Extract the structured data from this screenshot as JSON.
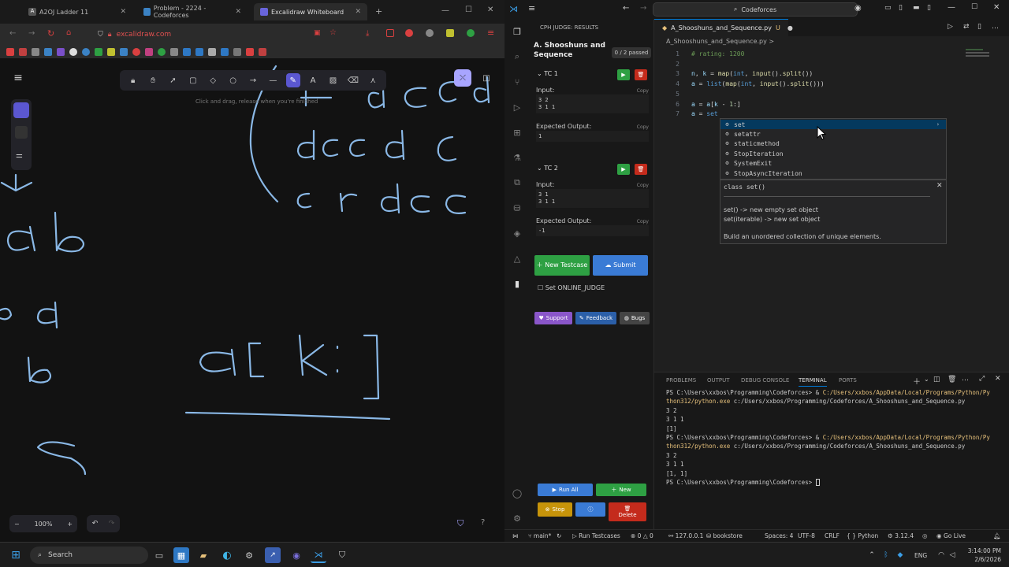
{
  "browser": {
    "tabs": [
      {
        "title": "A2OJ Ladder 11"
      },
      {
        "title": "Problem - 2224 - Codeforces"
      },
      {
        "title": "Excalidraw Whiteboard"
      }
    ],
    "url": "excalidraw.com"
  },
  "excalidraw": {
    "hint": "Click and drag, release when you're finished",
    "zoom": "100%"
  },
  "vscode": {
    "search": "Codeforces",
    "cph": {
      "header": "CPH JUDGE: RESULTS",
      "problem": "A. Shooshuns and Sequence",
      "passed": "0 / 2 passed",
      "testcases": [
        {
          "title": "TC 1",
          "input_label": "Input:",
          "input": "3 2\n3 1 1",
          "expected_label": "Expected Output:",
          "expected": "1",
          "copy": "Copy"
        },
        {
          "title": "TC 2",
          "input_label": "Input:",
          "input": "3 1\n3 1 1",
          "expected_label": "Expected Output:",
          "expected": "-1",
          "copy": "Copy"
        }
      ],
      "new_testcase": "New Testcase",
      "submit": "Submit",
      "online_judge": "Set ONLINE_JUDGE",
      "support": "Support",
      "feedback": "Feedback",
      "bugs": "Bugs",
      "run_all": "Run All",
      "new": "New",
      "stop": "Stop",
      "delete": "Delete"
    },
    "editor": {
      "tab": "A_Shooshuns_and_Sequence.py",
      "tab_status": "U",
      "breadcrumb": "A_Shooshuns_and_Sequence.py >",
      "suggestions": [
        "set",
        "setattr",
        "staticmethod",
        "StopIteration",
        "SystemExit",
        "StopAsyncIteration"
      ],
      "doc": {
        "signature": "class set()",
        "line1": "set() -> new empty set object",
        "line2": "set(iterable) -> new set object",
        "line3": "Build an unordered collection of unique elements."
      }
    },
    "panel": {
      "tabs": [
        "PROBLEMS",
        "OUTPUT",
        "DEBUG CONSOLE",
        "TERMINAL",
        "PORTS"
      ],
      "terminal": [
        {
          "prompt": "PS C:\\Users\\xxbos\\Programming\\Codeforces> & ",
          "path": "C:/Users/xxbos/AppData/Local/Programs/Python/Py"
        },
        {
          "prompt": "",
          "path": "thon312/python.exe",
          "rest": " c:/Users/xxbos/Programming/Codeforces/A_Shooshuns_and_Sequence.py"
        },
        {
          "prompt": "3 2"
        },
        {
          "prompt": "3 1 1"
        },
        {
          "prompt": "[1]"
        },
        {
          "prompt": "PS C:\\Users\\xxbos\\Programming\\Codeforces> & ",
          "path": "C:/Users/xxbos/AppData/Local/Programs/Python/Py"
        },
        {
          "prompt": "",
          "path": "thon312/python.exe",
          "rest": " c:/Users/xxbos/Programming/Codeforces/A_Shooshuns_and_Sequence.py"
        },
        {
          "prompt": "3 2"
        },
        {
          "prompt": "3 1 1"
        },
        {
          "prompt": "[1, 1]"
        },
        {
          "prompt": "PS C:\\Users\\xxbos\\Programming\\Codeforces> "
        }
      ]
    },
    "status": {
      "branch": "main*",
      "run": "Run Testcases",
      "errors": "0",
      "warnings": "0",
      "host": "127.0.0.1",
      "bookstore": "bookstore",
      "spaces": "Spaces: 4",
      "encoding": "UTF-8",
      "eol": "CRLF",
      "language": "Python",
      "version": "3.12.4",
      "golive": "Go Live"
    }
  },
  "taskbar": {
    "search": "Search",
    "lang": "ENG",
    "time": "3:14:00 PM",
    "date": "2/6/2026"
  },
  "colors": {
    "accent": "#0078d4",
    "run": "#2ea043",
    "delete": "#c42b1c",
    "new_testcase": "#2ea043",
    "submit": "#3a7bd5",
    "stop": "#c7940a",
    "purple": "#8a56c9",
    "excal_stroke": "#8ab8e6"
  }
}
